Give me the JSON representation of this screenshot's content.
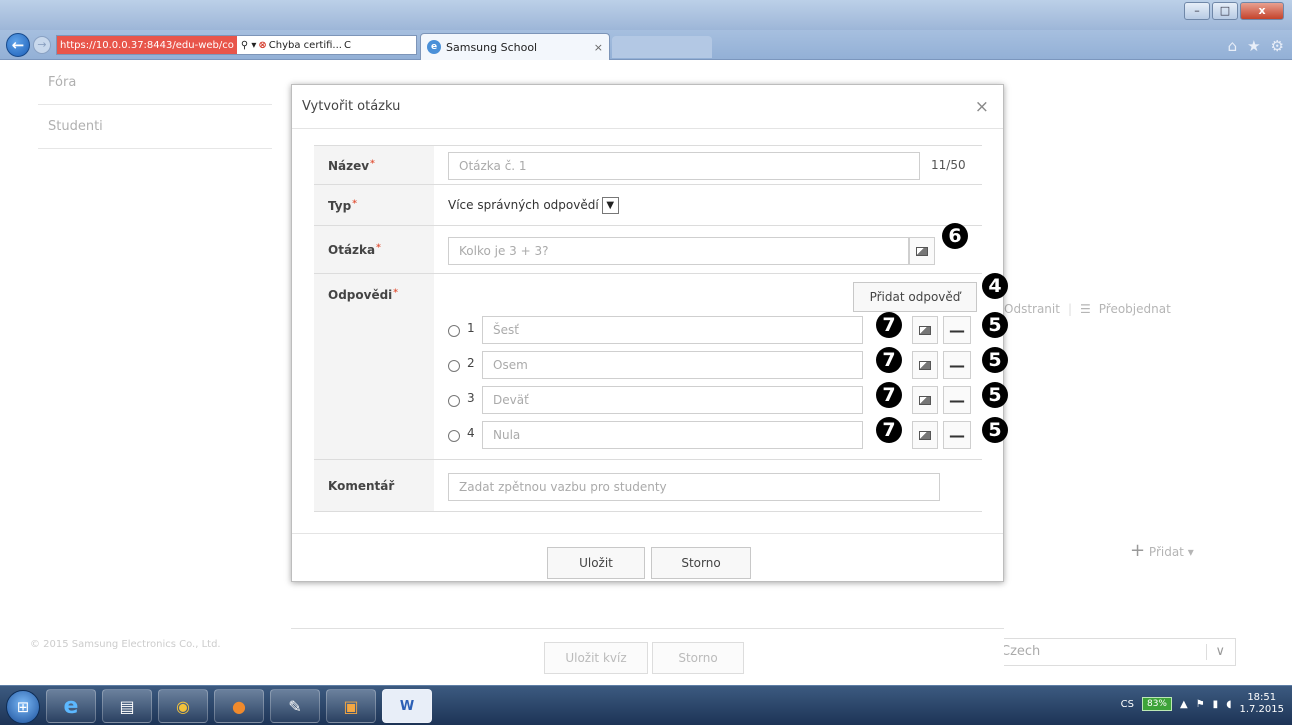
{
  "browser": {
    "address_error_text": "https://10.0.0.37:8443/edu-web/co",
    "search_glyph": "⚲ ▾",
    "cert_error_label": "Chyba certifi...",
    "refresh_glyph": "C",
    "tab_title": "Samsung School",
    "tab_close": "×",
    "win_min": "–",
    "win_max": "□",
    "win_close": "x",
    "icons": [
      "home-icon",
      "favorites-star-icon",
      "settings-gear-icon"
    ]
  },
  "background_page": {
    "sidebar": [
      "Fóra",
      "Studenti"
    ],
    "actions": {
      "delete": "Odstranit",
      "reorder": "Přeobjednat"
    },
    "add": "Přidat",
    "footer": "© 2015 Samsung Electronics Co., Ltd.",
    "language": "Czech",
    "save_quiz": "Uložit kvíz",
    "cancel": "Storno"
  },
  "modal": {
    "title": "Vytvořit otázku",
    "close": "×",
    "name": {
      "label": "Název",
      "placeholder": "Otázka č. 1",
      "counter": "11/50"
    },
    "type": {
      "label": "Typ",
      "value": "Více správných odpovědí"
    },
    "question": {
      "label": "Otázka",
      "placeholder": "Kolko je 3 + 3?"
    },
    "answers": {
      "label": "Odpovědi",
      "add_button": "Přidat odpověď",
      "items": [
        {
          "num": "1",
          "placeholder": "Šesť"
        },
        {
          "num": "2",
          "placeholder": "Osem"
        },
        {
          "num": "3",
          "placeholder": "Deväť"
        },
        {
          "num": "4",
          "placeholder": "Nula"
        }
      ],
      "remove_glyph": "—"
    },
    "comment": {
      "label": "Komentář",
      "placeholder": "Zadat zpětnou vazbu pro studenty"
    },
    "save": "Uložit",
    "cancel": "Storno"
  },
  "annotations": {
    "image_question": "6",
    "add_answer": "4",
    "remove_answer": "5",
    "image_answer": "7"
  },
  "taskbar": {
    "apps": [
      "internet-explorer",
      "file-explorer",
      "chrome",
      "firefox",
      "paint",
      "image-app",
      "word"
    ],
    "lang": "CS",
    "battery": "83%",
    "time": "18:51",
    "date": "1.7.2015"
  }
}
